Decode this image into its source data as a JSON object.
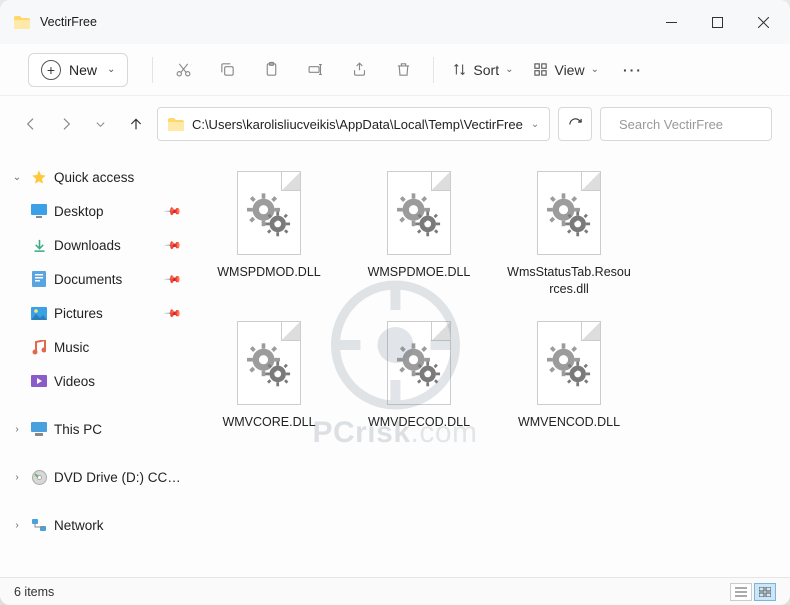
{
  "window": {
    "title": "VectirFree"
  },
  "toolbar": {
    "new_label": "New",
    "sort_label": "Sort",
    "view_label": "View"
  },
  "addressbar": {
    "path": "C:\\Users\\karolisliucveikis\\AppData\\Local\\Temp\\VectirFree"
  },
  "search": {
    "placeholder": "Search VectirFree"
  },
  "sidebar": {
    "quick_access": "Quick access",
    "items": [
      {
        "label": "Desktop"
      },
      {
        "label": "Downloads"
      },
      {
        "label": "Documents"
      },
      {
        "label": "Pictures"
      },
      {
        "label": "Music"
      },
      {
        "label": "Videos"
      }
    ],
    "this_pc": "This PC",
    "dvd": "DVD Drive (D:) CCCC",
    "network": "Network"
  },
  "files": [
    {
      "name": "WMSPDMOD.DLL"
    },
    {
      "name": "WMSPDMOE.DLL"
    },
    {
      "name": "WmsStatusTab.Resources.dll"
    },
    {
      "name": "WMVCORE.DLL"
    },
    {
      "name": "WMVDECOD.DLL"
    },
    {
      "name": "WMVENCOD.DLL"
    }
  ],
  "status": {
    "count": "6 items"
  },
  "watermark": {
    "line1": "PCrisk",
    "line2": ".com"
  }
}
